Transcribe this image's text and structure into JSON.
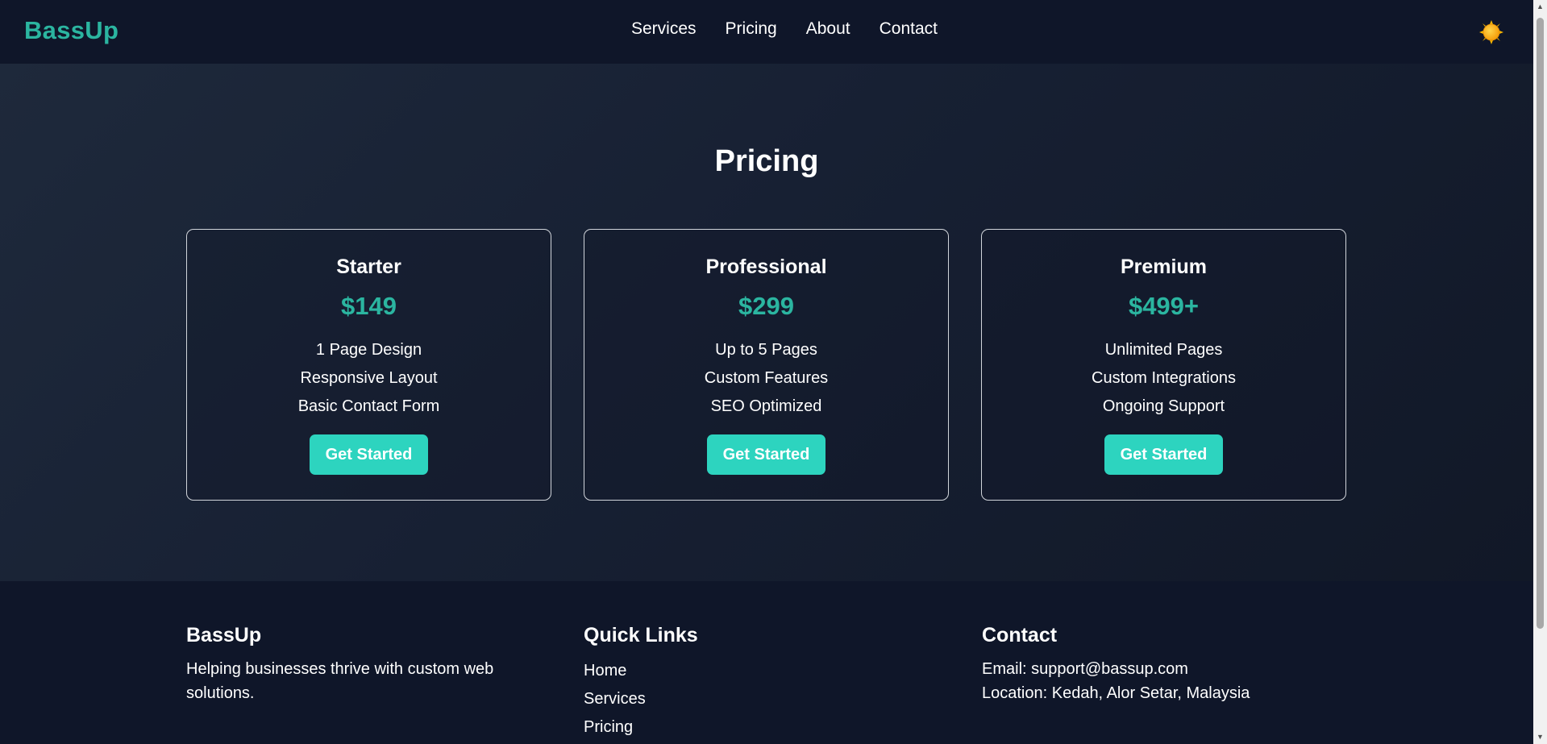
{
  "nav": {
    "logo": "BassUp",
    "links": [
      "Services",
      "Pricing",
      "About",
      "Contact"
    ],
    "theme_icon": "sun-icon"
  },
  "pricing": {
    "title": "Pricing",
    "plans": [
      {
        "name": "Starter",
        "price": "$149",
        "features": [
          "1 Page Design",
          "Responsive Layout",
          "Basic Contact Form"
        ],
        "cta": "Get Started"
      },
      {
        "name": "Professional",
        "price": "$299",
        "features": [
          "Up to 5 Pages",
          "Custom Features",
          "SEO Optimized"
        ],
        "cta": "Get Started"
      },
      {
        "name": "Premium",
        "price": "$499+",
        "features": [
          "Unlimited Pages",
          "Custom Integrations",
          "Ongoing Support"
        ],
        "cta": "Get Started"
      }
    ]
  },
  "footer": {
    "brand": {
      "title": "BassUp",
      "text": "Helping businesses thrive with custom web solutions."
    },
    "quick_links": {
      "title": "Quick Links",
      "links": [
        "Home",
        "Services",
        "Pricing"
      ]
    },
    "contact": {
      "title": "Contact",
      "email": "Email: support@bassup.com",
      "location": "Location: Kedah, Alor Setar, Malaysia"
    }
  },
  "colors": {
    "accent": "#2bb5a0",
    "button": "#2dd4bf",
    "background": "#0f172a"
  }
}
